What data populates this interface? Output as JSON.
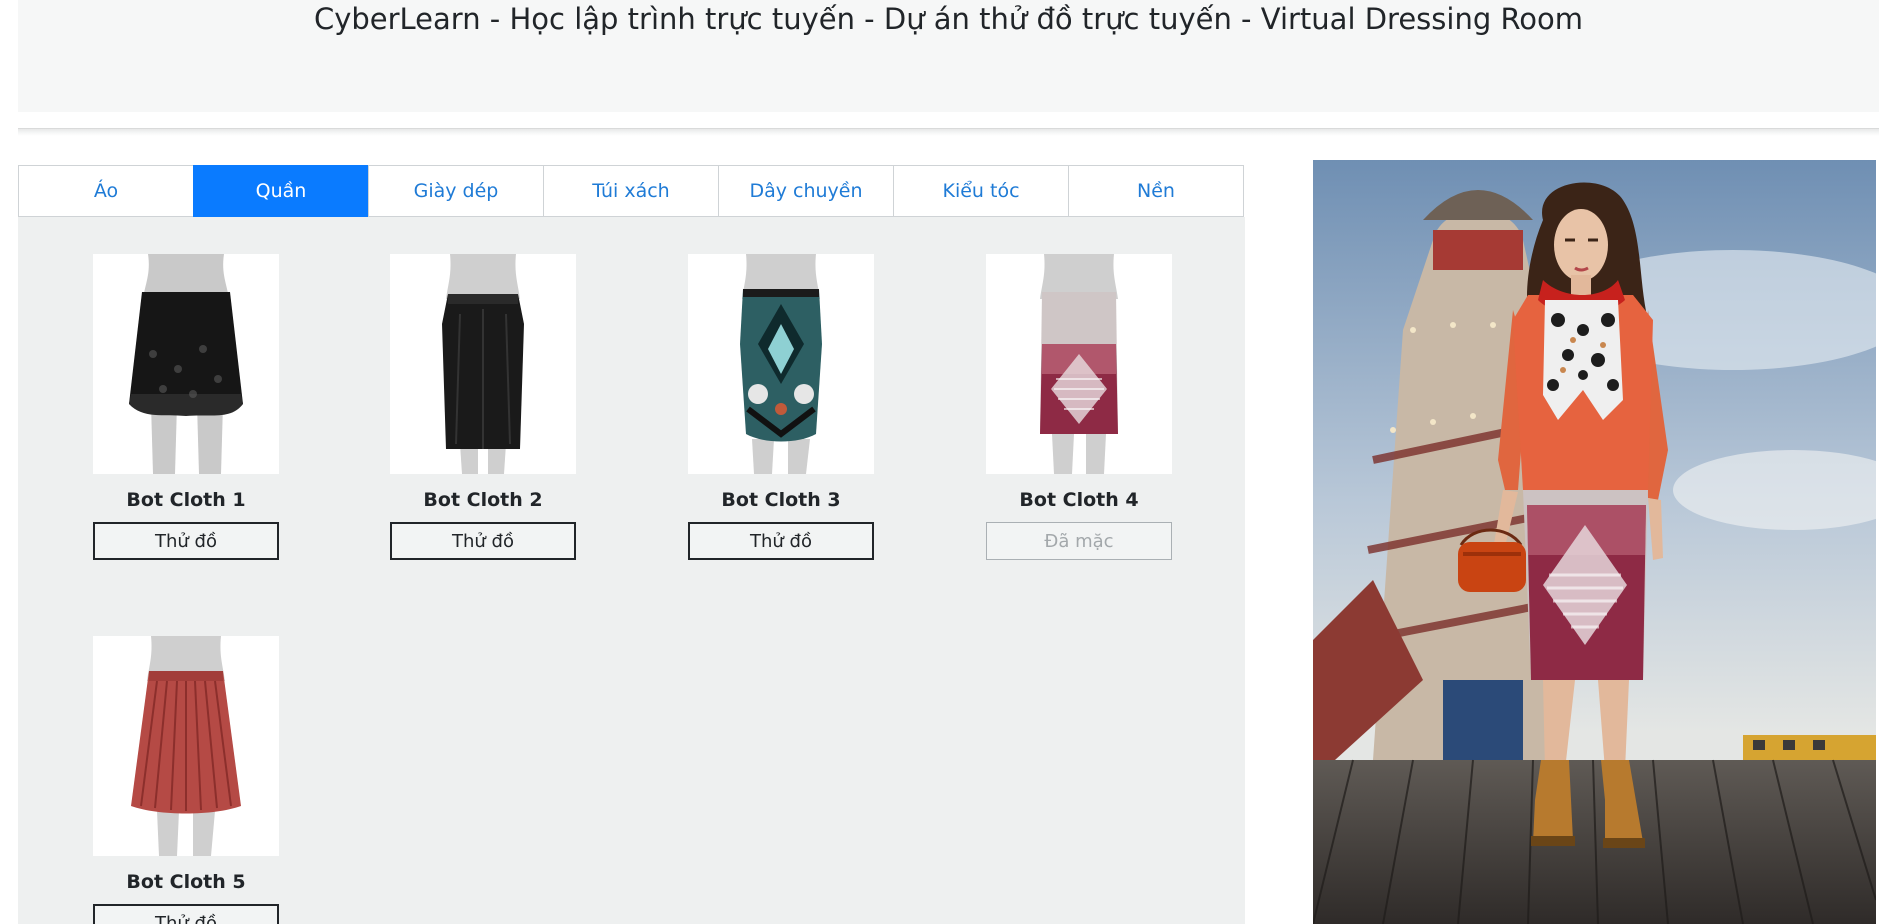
{
  "header": {
    "title": "CyberLearn - Học lập trình trực tuyến - Dự án thử đồ trực tuyến - Virtual Dressing Room"
  },
  "tabs": [
    {
      "label": "Áo",
      "active": false
    },
    {
      "label": "Quần",
      "active": true
    },
    {
      "label": "Giày dép",
      "active": false
    },
    {
      "label": "Túi xách",
      "active": false
    },
    {
      "label": "Dây chuyền",
      "active": false
    },
    {
      "label": "Kiểu tóc",
      "active": false
    },
    {
      "label": "Nền",
      "active": false
    }
  ],
  "products": [
    {
      "name": "Bot Cloth 1",
      "button": "Thử đồ",
      "worn": false,
      "icon": "black-lace-skirt"
    },
    {
      "name": "Bot Cloth 2",
      "button": "Thử đồ",
      "worn": false,
      "icon": "black-maxi-skirt"
    },
    {
      "name": "Bot Cloth 3",
      "button": "Thử đồ",
      "worn": false,
      "icon": "printed-pencil-skirt"
    },
    {
      "name": "Bot Cloth 4",
      "button": "Đã mặc",
      "worn": true,
      "icon": "pink-printed-skirt"
    },
    {
      "name": "Bot Cloth 5",
      "button": "Thử đồ",
      "worn": false,
      "icon": "red-pleated-skirt"
    }
  ],
  "colors": {
    "active_tab": "#0a7bff",
    "tab_text": "#1f7bd6",
    "panel_bg": "#eef0f0"
  }
}
